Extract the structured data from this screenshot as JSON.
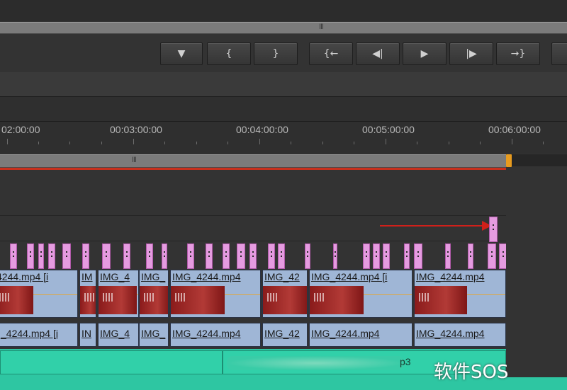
{
  "transport": {
    "buttons": [
      {
        "name": "add-marker-button",
        "glyph": "▼"
      },
      {
        "name": "mark-in-button",
        "glyph": "{"
      },
      {
        "name": "mark-out-button",
        "glyph": "}"
      },
      {
        "name": "go-to-in-button",
        "glyph": "{←"
      },
      {
        "name": "step-back-button",
        "glyph": "◀|"
      },
      {
        "name": "play-button",
        "glyph": "▶"
      },
      {
        "name": "step-forward-button",
        "glyph": "|▶"
      },
      {
        "name": "go-to-out-button",
        "glyph": "→}"
      }
    ]
  },
  "ruler": {
    "timecodes": [
      "02:00:00",
      "00:03:00:00",
      "00:04:00:00",
      "00:05:00:00",
      "00:06:00:00"
    ]
  },
  "video_clips": [
    {
      "label": "4244.mp4 [i"
    },
    {
      "label": "IM"
    },
    {
      "label": "IMG_4"
    },
    {
      "label": "IMG_"
    },
    {
      "label": "IMG_4244.mp4"
    },
    {
      "label": "IMG_42"
    },
    {
      "label": "IMG_4244.mp4 [i"
    },
    {
      "label": "IMG_4244.mp4"
    }
  ],
  "audio_clips": [
    {
      "label": "_4244.mp4 [i"
    },
    {
      "label": "IN"
    },
    {
      "label": "IMG_4"
    },
    {
      "label": "IMG_"
    },
    {
      "label": "IMG_4244.mp4"
    },
    {
      "label": "IMG_42"
    },
    {
      "label": "IMG_4244.mp4"
    },
    {
      "label": "IMG_4244.mp4"
    }
  ],
  "green_track": {
    "label": "p3"
  },
  "watermark": {
    "text": "软件SOS"
  },
  "colors": {
    "background": "#333333",
    "clip_blue": "#9fb6d6",
    "marker_pink": "#e59be0",
    "playhead_red": "#c8301d",
    "audio_green": "#2ec6a2",
    "out_point_orange": "#e79b1f"
  }
}
